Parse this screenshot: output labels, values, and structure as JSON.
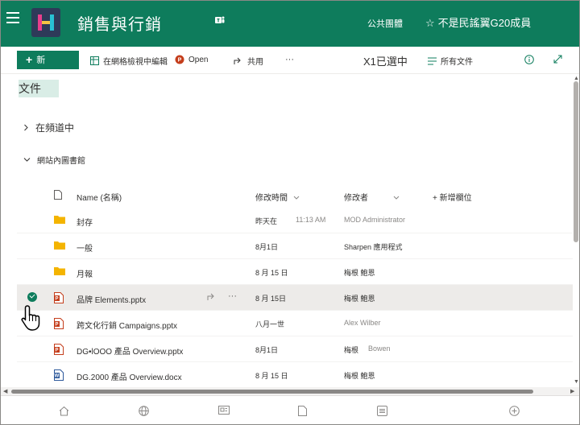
{
  "header": {
    "site_title": "銷售與行銷",
    "privacy": "公共團體",
    "follow": "不是民謠翼G20成員",
    "star": "☆"
  },
  "commands": {
    "new": "新",
    "edit_grid": "在網格檢視中編輯",
    "open": "Open",
    "share": "共用",
    "more": "···",
    "selected": "X1已選中",
    "all_docs": "所有文件"
  },
  "library": {
    "title": "文件",
    "group_collapsed": "在頻道中",
    "group_expanded": "網站內圖書館"
  },
  "columns": {
    "name": "Name (名稱)",
    "modified": "修改時間",
    "modified_by": "修改者",
    "add_column": "+ 新增欄位"
  },
  "rows": [
    {
      "name": "封存",
      "modified": "昨天在",
      "time": "11:13 AM",
      "by": "MOD Administrator",
      "by2": ""
    },
    {
      "name": "一般",
      "modified": "8月1日",
      "time": "",
      "by": "Sharpen 應用程式",
      "by2": ""
    },
    {
      "name": "月報",
      "modified": "8 月 15 日",
      "time": "",
      "by": "梅根 鮑恩",
      "by2": ""
    },
    {
      "name": "品牌 Elements.pptx",
      "modified": "8 月 15日",
      "time": "",
      "by": "梅根 鮑恩",
      "by2": ""
    },
    {
      "name": "跨文化行銷  Campaigns.pptx",
      "modified": "八月一世",
      "time": "",
      "by": "Alex Wilber",
      "by2": ""
    },
    {
      "name": "DG•lOOO 產品 Overview.pptx",
      "modified": "8月1日",
      "time": "",
      "by": "梅根",
      "by2": "Bowen"
    },
    {
      "name": "DG.2000 產品 Overview.docx",
      "modified": "8 月 15 日",
      "time": "",
      "by": "梅根 鮑恩",
      "by2": ""
    }
  ],
  "colors": {
    "brand": "#0e7c5c",
    "ppt": "#c43e1c",
    "word": "#2b579a",
    "folder": "#f4b400"
  }
}
